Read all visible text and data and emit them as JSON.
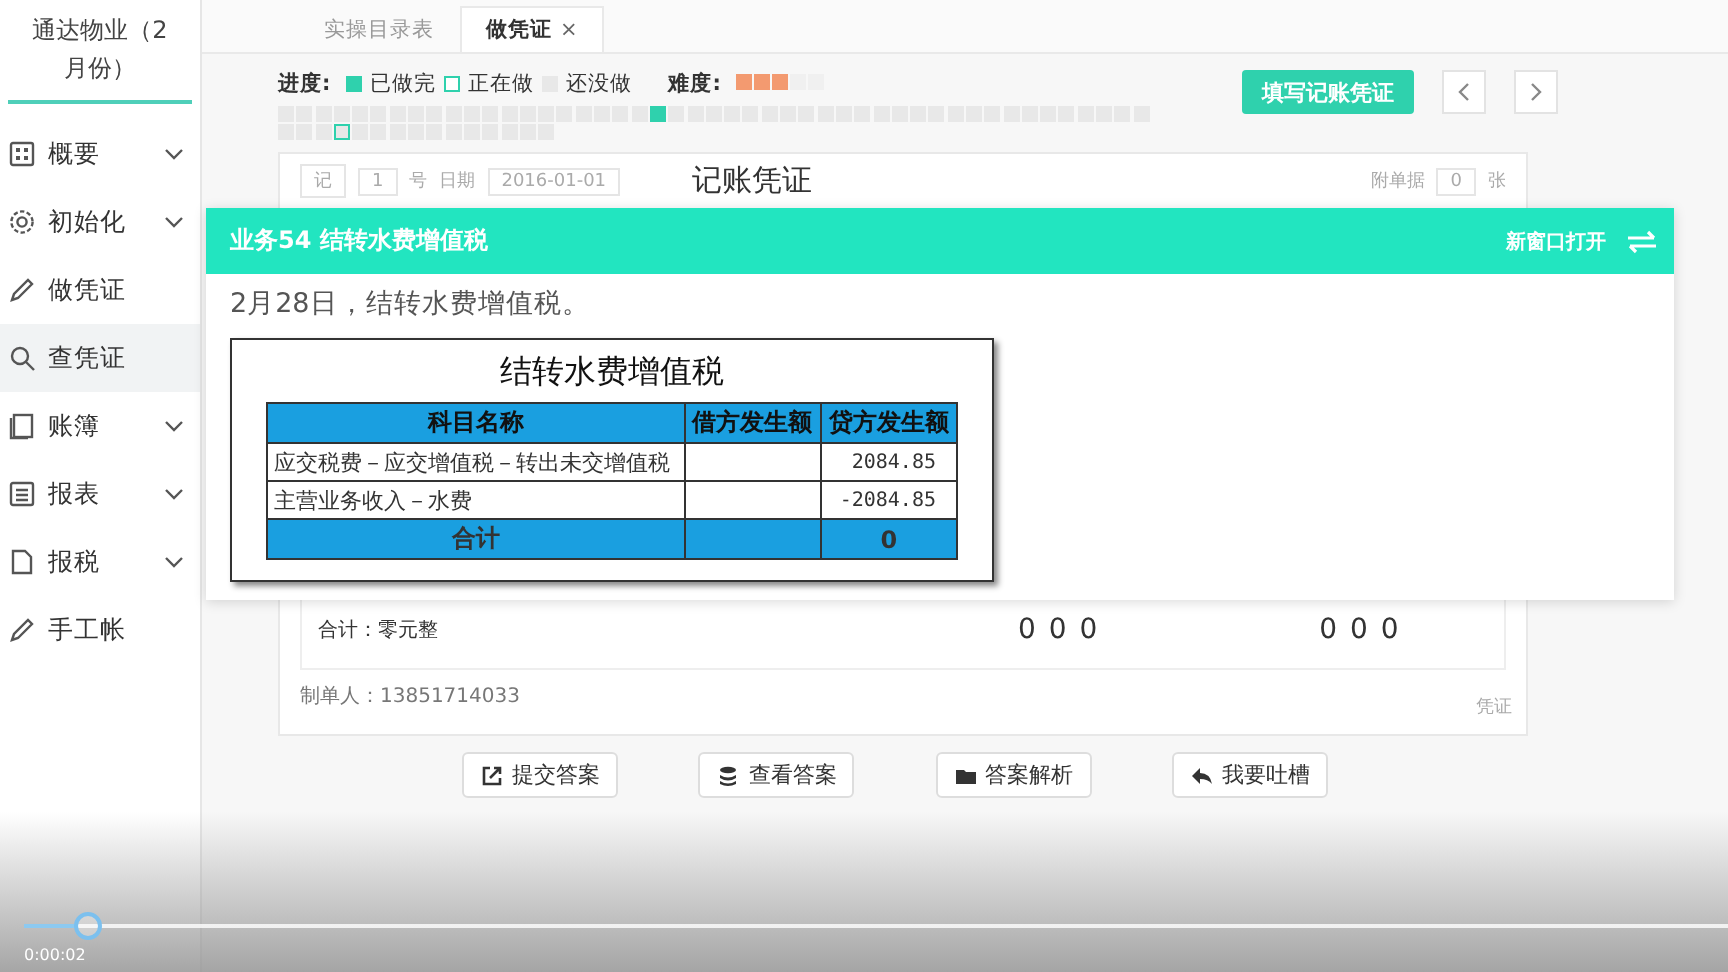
{
  "sidebar": {
    "title": "通达物业（2月份）",
    "items": [
      {
        "label": "概要",
        "kind": "grid",
        "expandable": true,
        "selected": false
      },
      {
        "label": "初始化",
        "kind": "gear",
        "expandable": true,
        "selected": false
      },
      {
        "label": "做凭证",
        "kind": "pencil",
        "expandable": false,
        "selected": false
      },
      {
        "label": "查凭证",
        "kind": "search",
        "expandable": false,
        "selected": true
      },
      {
        "label": "账簿",
        "kind": "book",
        "expandable": true,
        "selected": false
      },
      {
        "label": "报表",
        "kind": "list",
        "expandable": true,
        "selected": false
      },
      {
        "label": "报税",
        "kind": "doc",
        "expandable": true,
        "selected": false
      },
      {
        "label": "手工帐",
        "kind": "pencil",
        "expandable": false,
        "selected": false
      }
    ]
  },
  "tabs": [
    {
      "label": "实操目录表",
      "selected": false,
      "closable": false
    },
    {
      "label": "做凭证",
      "selected": true,
      "closable": true,
      "close": "×"
    }
  ],
  "progress": {
    "label": "进度:",
    "legend": [
      {
        "label": "已做完",
        "kind": "done"
      },
      {
        "label": "正在做",
        "kind": "doing"
      },
      {
        "label": "还没做",
        "kind": "todo"
      }
    ],
    "difficulty_label": "难度:",
    "stars": 3,
    "cells": [
      {
        "done": false,
        "current": false
      },
      {
        "done": false,
        "current": false
      },
      {
        "done": false,
        "current": false
      },
      {
        "done": false,
        "current": false
      },
      {
        "done": false,
        "current": false
      },
      {
        "done": false,
        "current": false
      },
      {
        "done": false,
        "current": false
      },
      {
        "done": false,
        "current": false
      },
      {
        "done": false,
        "current": false
      },
      {
        "done": false,
        "current": false
      },
      {
        "done": false,
        "current": false
      },
      {
        "done": false,
        "current": false
      },
      {
        "done": false,
        "current": false
      },
      {
        "done": false,
        "current": false
      },
      {
        "done": false,
        "current": false
      },
      {
        "done": false,
        "current": false
      },
      {
        "done": false,
        "current": false
      },
      {
        "done": false,
        "current": false
      },
      {
        "done": false,
        "current": false
      },
      {
        "done": false,
        "current": false
      },
      {
        "done": true,
        "current": false
      },
      {
        "done": false,
        "current": false
      },
      {
        "done": false,
        "current": false
      },
      {
        "done": false,
        "current": false
      },
      {
        "done": false,
        "current": false
      },
      {
        "done": false,
        "current": false
      },
      {
        "done": false,
        "current": false
      },
      {
        "done": false,
        "current": false
      },
      {
        "done": false,
        "current": false
      },
      {
        "done": false,
        "current": false
      },
      {
        "done": false,
        "current": false
      },
      {
        "done": false,
        "current": false
      },
      {
        "done": false,
        "current": false
      },
      {
        "done": false,
        "current": false
      },
      {
        "done": false,
        "current": false
      },
      {
        "done": false,
        "current": false
      },
      {
        "done": false,
        "current": false
      },
      {
        "done": false,
        "current": false
      },
      {
        "done": false,
        "current": false
      },
      {
        "done": false,
        "current": false
      },
      {
        "done": false,
        "current": false
      },
      {
        "done": false,
        "current": false
      },
      {
        "done": false,
        "current": false
      },
      {
        "done": false,
        "current": false
      },
      {
        "done": false,
        "current": false
      },
      {
        "done": false,
        "current": false
      },
      {
        "done": false,
        "current": false
      },
      {
        "done": false,
        "current": false
      },
      {
        "done": false,
        "current": false
      },
      {
        "done": false,
        "current": false
      },
      {
        "done": false,
        "current": true
      },
      {
        "done": false,
        "current": false
      },
      {
        "done": false,
        "current": false
      },
      {
        "done": false,
        "current": false
      },
      {
        "done": false,
        "current": false
      },
      {
        "done": false,
        "current": false
      },
      {
        "done": false,
        "current": false
      },
      {
        "done": false,
        "current": false
      },
      {
        "done": false,
        "current": false
      },
      {
        "done": false,
        "current": false
      },
      {
        "done": false,
        "current": false
      },
      {
        "done": false,
        "current": false
      }
    ]
  },
  "fill_button": "填写记账凭证",
  "voucher": {
    "word": "记",
    "number": "1",
    "number_unit": "号",
    "date_label": "日期",
    "date": "2016-01-01",
    "title": "记账凭证",
    "attachments_label": "附单据",
    "attachments": "0",
    "attachments_unit": "张",
    "total_text": "合计：零元整",
    "debit_total": "0 0 0",
    "credit_total": "0 0 0",
    "preparer": "制单人：13851714033",
    "side_text": "凭证"
  },
  "popup": {
    "title": "业务54 结转水费增值税",
    "open_new": "新窗口打开",
    "description": "2月28日，结转水费增值税。",
    "table": {
      "title": "结转水费增值税",
      "columns": [
        "科目名称",
        "借方发生额",
        "贷方发生额"
      ],
      "rows": [
        {
          "account": "应交税费－应交增值税－转出未交增值税",
          "credit": "2084.85"
        },
        {
          "account": "主营业务收入－水费",
          "credit": "-2084.85"
        }
      ],
      "total": {
        "account": "合计",
        "credit": "0"
      }
    }
  },
  "actions": [
    {
      "label": "提交答案",
      "kind": "submit"
    },
    {
      "label": "查看答案",
      "kind": "view"
    },
    {
      "label": "答案解析",
      "kind": "analysis"
    },
    {
      "label": "我要吐槽",
      "kind": "feedback"
    }
  ],
  "player": {
    "level": 0.03,
    "time": "0:00:02"
  }
}
